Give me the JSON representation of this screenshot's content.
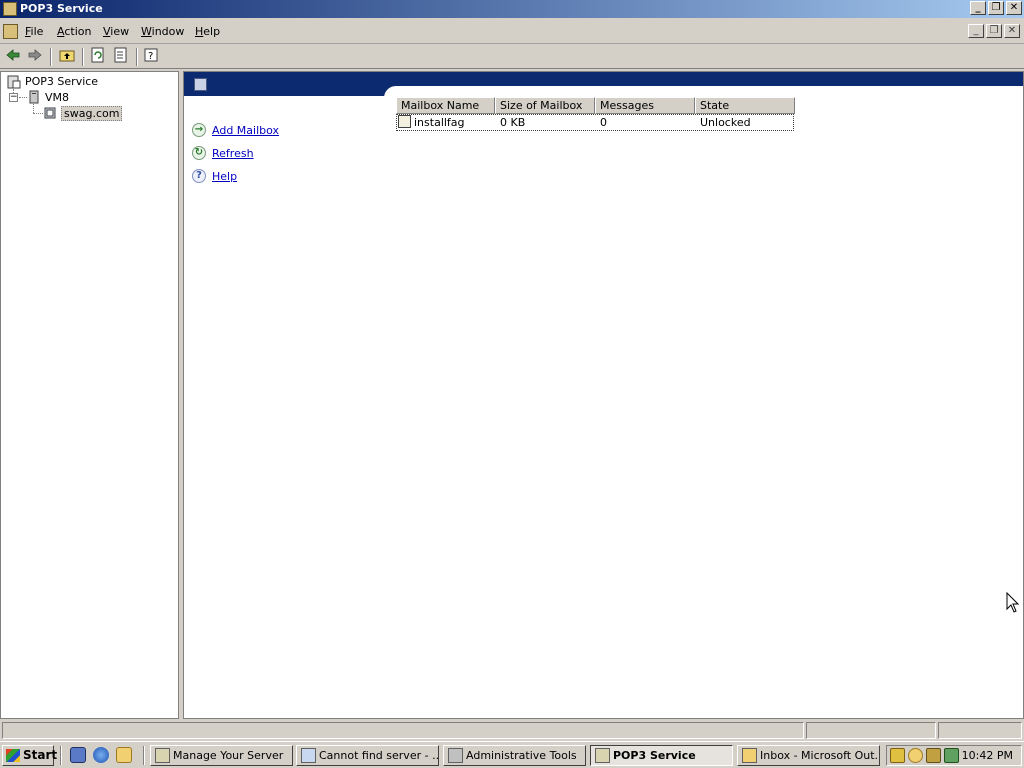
{
  "window": {
    "title": "POP3 Service",
    "title_buttons": [
      "_",
      "❐",
      "✕"
    ]
  },
  "menu": {
    "items": [
      "File",
      "Action",
      "View",
      "Window",
      "Help"
    ],
    "mdi_buttons": [
      "_",
      "❐",
      "✕"
    ]
  },
  "toolbar": {
    "buttons": [
      "back-icon",
      "forward-icon",
      "up-folder-icon",
      "refresh-icon",
      "export-list-icon",
      "help-icon"
    ]
  },
  "tree": {
    "root": "POP3 Service",
    "server": "VM8",
    "domain": "swag.com",
    "expander": "−"
  },
  "tasks": [
    {
      "label": "Add Mailbox",
      "icon": "→"
    },
    {
      "label": "Refresh",
      "icon": "↻"
    },
    {
      "label": "Help",
      "icon": "?"
    }
  ],
  "table": {
    "columns": [
      "Mailbox Name",
      "Size of Mailbox",
      "Messages",
      "State"
    ],
    "rows": [
      {
        "name": "installfag",
        "size": "0 KB",
        "messages": "0",
        "state": "Unlocked"
      }
    ]
  },
  "taskbar": {
    "start_label": "Start",
    "buttons": [
      {
        "label": "Manage Your Server"
      },
      {
        "label": "Cannot find server - ..."
      },
      {
        "label": "Administrative Tools"
      },
      {
        "label": "POP3 Service"
      },
      {
        "label": "Inbox - Microsoft Out..."
      }
    ],
    "clock": "10:42 PM"
  }
}
